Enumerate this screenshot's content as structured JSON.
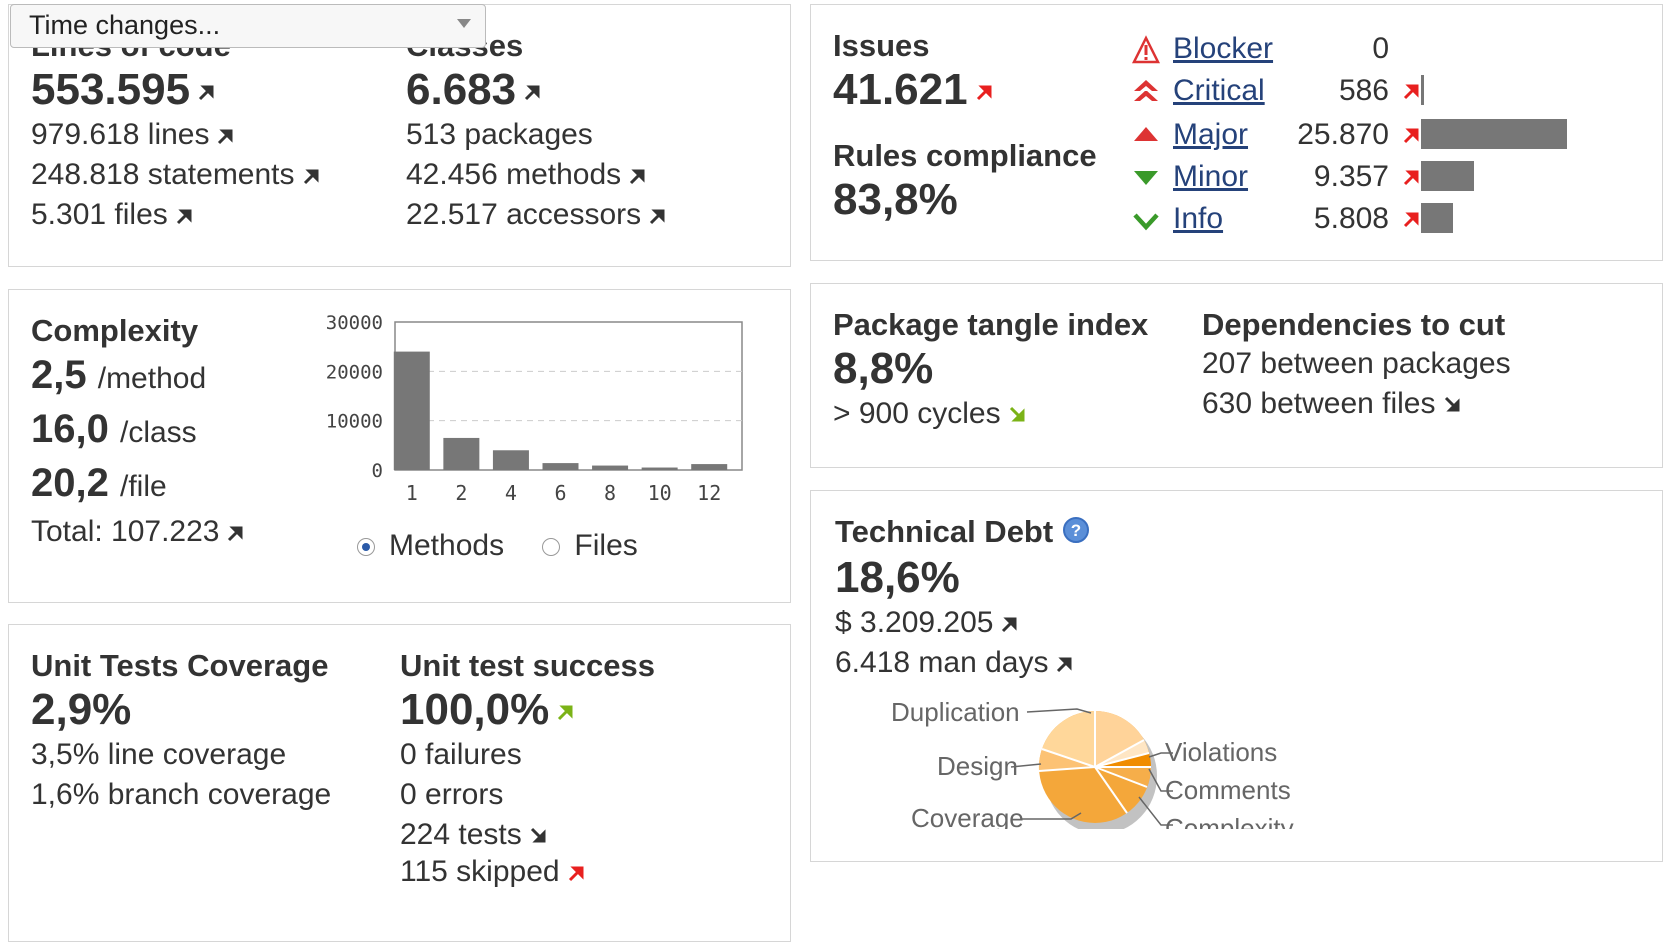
{
  "time_select": {
    "label": "Time changes..."
  },
  "size": {
    "loc_label": "Lines of code",
    "loc_value": "553.595",
    "lines": "979.618 lines",
    "statements": "248.818 statements",
    "files": "5.301 files",
    "classes_label": "Classes",
    "classes_value": "6.683",
    "packages": "513 packages",
    "methods": "42.456 methods",
    "accessors": "22.517 accessors"
  },
  "issues": {
    "label": "Issues",
    "value": "41.621",
    "rules_label": "Rules compliance",
    "rules_value": "83,8%",
    "severities": [
      {
        "name": "Blocker",
        "value": "0",
        "icon": "blocker-icon",
        "bar_fraction": 0
      },
      {
        "name": "Critical",
        "value": "586",
        "icon": "critical-icon",
        "bar_fraction": 0.02
      },
      {
        "name": "Major",
        "value": "25.870",
        "icon": "major-icon",
        "bar_fraction": 1.0
      },
      {
        "name": "Minor",
        "value": "9.357",
        "icon": "minor-icon",
        "bar_fraction": 0.36
      },
      {
        "name": "Info",
        "value": "5.808",
        "icon": "info-icon",
        "bar_fraction": 0.22
      }
    ]
  },
  "complexity": {
    "label": "Complexity",
    "method_value": "2,5",
    "method_unit": "/method",
    "class_value": "16,0",
    "class_unit": "/class",
    "file_value": "20,2",
    "file_unit": "/file",
    "total": "Total: 107.223",
    "radio_methods": "Methods",
    "radio_files": "Files"
  },
  "chart_data": {
    "type": "bar",
    "categories": [
      "1",
      "2",
      "4",
      "6",
      "8",
      "10",
      "12"
    ],
    "values": [
      24000,
      6500,
      4000,
      1400,
      900,
      500,
      1200
    ],
    "ylim": [
      0,
      30000
    ],
    "yticks": [
      "0",
      "10000",
      "20000",
      "30000"
    ],
    "grid": true
  },
  "tangle": {
    "label": "Package tangle index",
    "value": "8,8%",
    "cycles": "> 900 cycles",
    "deps_label": "Dependencies to cut",
    "between_packages": "207 between packages",
    "between_files": "630 between files"
  },
  "debt": {
    "label": "Technical Debt",
    "value": "18,6%",
    "cost": "$ 3.209.205",
    "days": "6.418 man days",
    "pie_labels": [
      "Duplication",
      "Design",
      "Coverage",
      "Violations",
      "Comments",
      "Complexity"
    ]
  },
  "tests": {
    "coverage_label": "Unit Tests Coverage",
    "coverage_value": "2,9%",
    "line_coverage": "3,5% line coverage",
    "branch_coverage": "1,6% branch coverage",
    "success_label": "Unit test success",
    "success_value": "100,0%",
    "failures": "0 failures",
    "errors": "0 errors",
    "tests": "224 tests",
    "skipped": "115 skipped"
  },
  "colors": {
    "trend_dark": "#333333",
    "trend_red": "#e8201f",
    "trend_green": "#7bb317",
    "bar": "#777777",
    "link": "#25427a"
  }
}
